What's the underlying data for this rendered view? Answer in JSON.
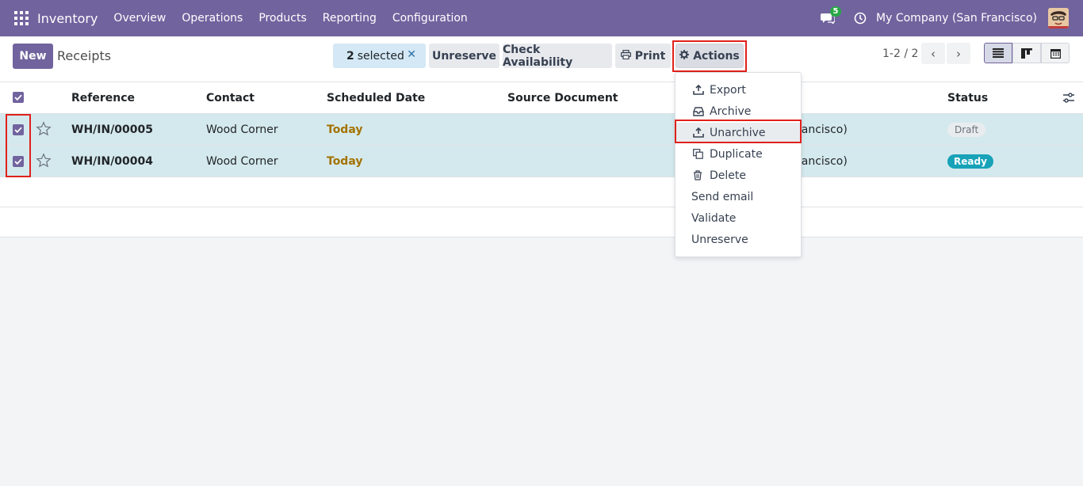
{
  "navbar": {
    "app_name": "Inventory",
    "menu": [
      "Overview",
      "Operations",
      "Products",
      "Reporting",
      "Configuration"
    ],
    "chat_badge": "5",
    "company": "My Company (San Francisco)"
  },
  "control_panel": {
    "new_label": "New",
    "title": "Receipts",
    "selected_count": "2",
    "selected_label": "selected",
    "clear_selection": "✕",
    "unreserve_label": "Unreserve",
    "check_availability_label": "Check Availability",
    "print_label": "Print",
    "actions_label": "Actions",
    "pager_value": "1-2 / 2",
    "pager_prev": "‹",
    "pager_next": "›"
  },
  "table": {
    "columns": [
      "Reference",
      "Contact",
      "Scheduled Date",
      "Source Document",
      "Status"
    ],
    "rows": [
      {
        "reference": "WH/IN/00005",
        "contact": "Wood Corner",
        "scheduled_date": "Today",
        "company_partial": "rancisco)",
        "status": "Draft"
      },
      {
        "reference": "WH/IN/00004",
        "contact": "Wood Corner",
        "scheduled_date": "Today",
        "company_partial": "rancisco)",
        "status": "Ready"
      }
    ]
  },
  "actions_menu": {
    "items": [
      "Export",
      "Archive",
      "Unarchive",
      "Duplicate",
      "Delete",
      "Send email",
      "Validate",
      "Unreserve"
    ],
    "active_item": "Unarchive"
  },
  "colors": {
    "brand": "#71639e",
    "selected_row": "#d4e9ed",
    "today": "#a37200",
    "ready": "#17a2b8",
    "highlight": "#e0211b"
  },
  "icons": [
    "apps-grid-icon",
    "chat-icon",
    "clock-icon",
    "avatar",
    "print-icon",
    "gear-icon",
    "chevron-left-icon",
    "chevron-right-icon",
    "list-view-icon",
    "kanban-view-icon",
    "calendar-view-icon",
    "check-icon",
    "star-icon",
    "settings-sliders-icon",
    "upload-icon",
    "inbox-icon",
    "copy-icon",
    "trash-icon"
  ]
}
